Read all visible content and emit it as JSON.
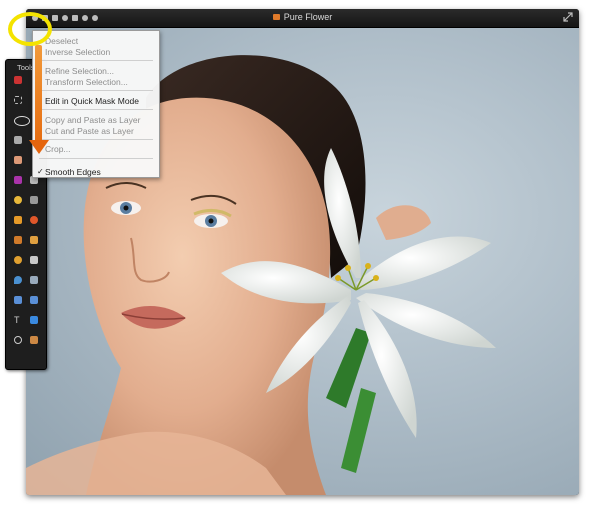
{
  "window": {
    "title": "Pure Flower"
  },
  "edit_menu": {
    "items": [
      {
        "label": "Deselect",
        "enabled": false
      },
      {
        "label": "Inverse Selection",
        "enabled": false
      },
      {
        "label": "Refine Selection...",
        "enabled": false
      },
      {
        "label": "Transform Selection...",
        "enabled": false
      },
      {
        "label": "Edit in Quick Mask Mode",
        "enabled": true
      },
      {
        "label": "Copy and Paste as Layer",
        "enabled": false
      },
      {
        "label": "Cut and Paste as Layer",
        "enabled": false
      },
      {
        "label": "Crop...",
        "enabled": false
      },
      {
        "label": "Smooth Edges",
        "enabled": true,
        "checked": true
      }
    ],
    "check_mark": "✓"
  },
  "tools_panel": {
    "title": "Tools"
  },
  "colors": {
    "highlight_ring": "#f4e300",
    "arrow": "#e56b10",
    "window_bg": "#1b1b1b",
    "doc_icon": "#e07a2a"
  },
  "icons": [
    "doc-icon",
    "expand-icon",
    "check-icon"
  ]
}
